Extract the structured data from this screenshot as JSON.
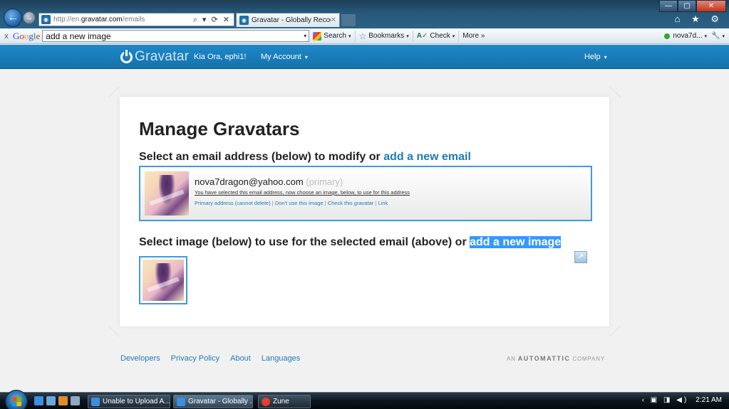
{
  "browser": {
    "address_url_prefix": "http://en.",
    "address_url_domain": "gravatar.com",
    "address_url_path": "/emails",
    "address_controls": "⌕ ▾ ⟳ ✕",
    "tab_title": "Gravatar - Globally Recogni...",
    "tab_close": "✕",
    "window_buttons": {
      "minimize": "—",
      "maximize": "▢",
      "close": "✕"
    },
    "tools_icons": "⌂ ★ ⚙"
  },
  "google_toolbar": {
    "close": "x",
    "logo": {
      "G": "G",
      "o1": "o",
      "o2": "o",
      "g": "g",
      "l": "l",
      "e": "e"
    },
    "search_value": "add a new image",
    "search_dropdown": "▾",
    "search_label": "Search",
    "bookmarks_label": "Bookmarks",
    "check_label": "Check",
    "more_label": "More »",
    "account_label": "nova7d...",
    "caret": "▾",
    "wrench": "🔧"
  },
  "site_header": {
    "logo_text": "Gravatar",
    "greeting": "Kia Ora, ephi1!",
    "my_account": "My Account",
    "help": "Help",
    "caret": "▾"
  },
  "main": {
    "title": "Manage Gravatars",
    "email_section_text": "Select an email address (below) to modify or ",
    "email_section_link": "add a new email",
    "email": {
      "address": "nova7dragon@yahoo.com",
      "primary_tag": "(primary)",
      "selected_note": "You have selected this email address, now choose an image, below, to use for this address",
      "links": [
        "Primary address (cannot delete)",
        "Don't use this image",
        "Check this gravatar",
        "Link"
      ],
      "separator": " | "
    },
    "image_section_text": "Select image (below) to use for the selected email (above) or ",
    "image_section_link": "add a new image",
    "popout_icon": "↗"
  },
  "footer": {
    "links": [
      "Developers",
      "Privacy Policy",
      "About",
      "Languages"
    ],
    "company_prefix": "AN ",
    "company_name": "AUTOMATTIC",
    "company_suffix": " COMPANY"
  },
  "taskbar": {
    "tasks": [
      "Unable to Upload A...",
      "Gravatar - Globally ...",
      "Zune"
    ],
    "tray_icons": "‹ ▣ ◨ ◀)",
    "clock": "2:21 AM"
  },
  "colors": {
    "gravatar_blue": "#1e7bb9",
    "header_blue": "#1b80bd",
    "selection_highlight": "#3399ff"
  }
}
